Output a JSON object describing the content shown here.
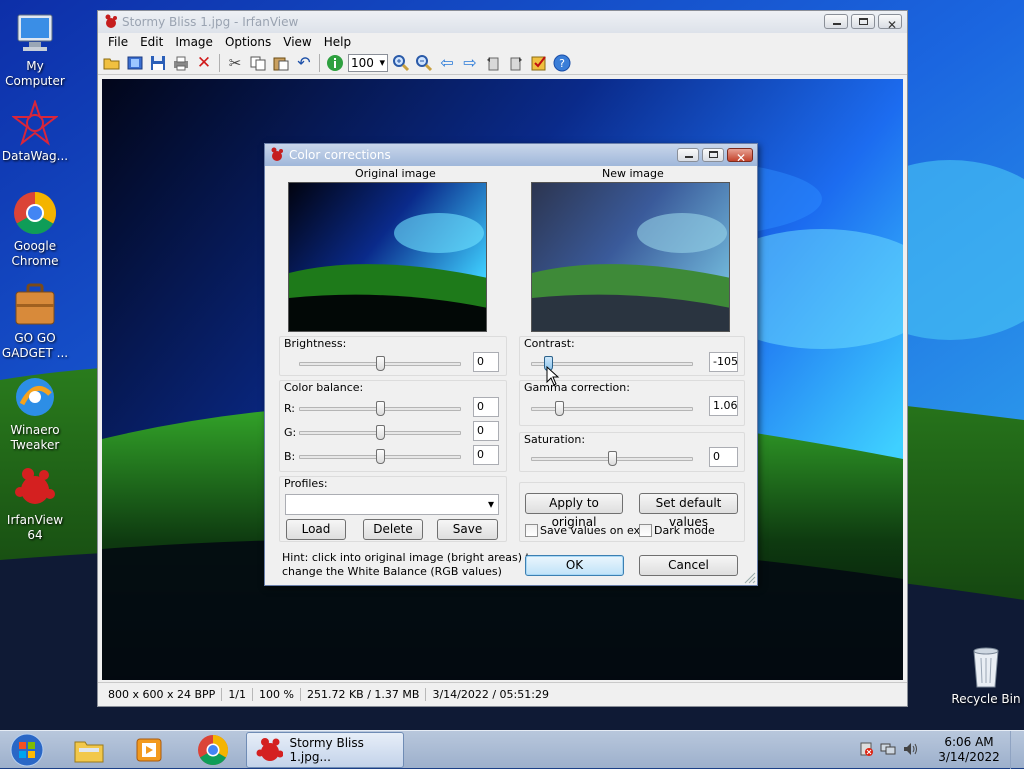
{
  "desktop": {
    "icons": [
      {
        "label_lines": [
          "My",
          "Computer"
        ],
        "icon": "computer-icon"
      },
      {
        "label_lines": [
          "DataWag..."
        ],
        "icon": "datawag-icon"
      },
      {
        "label_lines": [
          "Google",
          "Chrome"
        ],
        "icon": "chrome-icon"
      },
      {
        "label_lines": [
          "GO GO",
          "GADGET ..."
        ],
        "icon": "briefcase-icon"
      },
      {
        "label_lines": [
          "Winaero",
          "Tweaker"
        ],
        "icon": "winaero-icon"
      },
      {
        "label_lines": [
          "IrfanView 64"
        ],
        "icon": "irfanview-icon"
      },
      {
        "label_lines": [
          "Recycle Bin"
        ],
        "icon": "recycle-bin-icon"
      }
    ]
  },
  "irfanview": {
    "title": "Stormy Bliss 1.jpg - IrfanView",
    "menu": [
      "File",
      "Edit",
      "Image",
      "Options",
      "View",
      "Help"
    ],
    "zoom_value": "100",
    "status": [
      "800 x 600 x 24 BPP",
      "1/1",
      "100 %",
      "251.72 KB / 1.37 MB",
      "3/14/2022 / 05:51:29"
    ]
  },
  "dialog": {
    "title": "Color corrections",
    "original_label": "Original image",
    "new_label": "New image",
    "brightness": {
      "label": "Brightness:",
      "value": "0",
      "level": 0.5
    },
    "color_balance": {
      "label": "Color balance:",
      "r": {
        "label": "R:",
        "value": "0",
        "level": 0.5
      },
      "g": {
        "label": "G:",
        "value": "0",
        "level": 0.5
      },
      "b": {
        "label": "B:",
        "value": "0",
        "level": 0.5
      }
    },
    "profiles": {
      "label": "Profiles:",
      "selected": "",
      "load": "Load",
      "delete": "Delete",
      "save": "Save"
    },
    "hint_lines": [
      "Hint: click into original image (bright areas) to",
      "change the White Balance (RGB values)"
    ],
    "contrast": {
      "label": "Contrast:",
      "value": "-105",
      "level": 0.1
    },
    "gamma": {
      "label": "Gamma correction:",
      "value": "1.06",
      "level": 0.17
    },
    "saturation": {
      "label": "Saturation:",
      "value": "0",
      "level": 0.5
    },
    "apply_original": "Apply to original",
    "set_default": "Set default values",
    "save_on_exit": {
      "label": "Save values on exit",
      "checked": false
    },
    "dark_mode": {
      "label": "Dark mode",
      "checked": false
    },
    "ok": "OK",
    "cancel": "Cancel"
  },
  "taskbar": {
    "active_task": "Stormy Bliss 1.jpg...",
    "time": "6:06 AM",
    "date": "3/14/2022"
  }
}
